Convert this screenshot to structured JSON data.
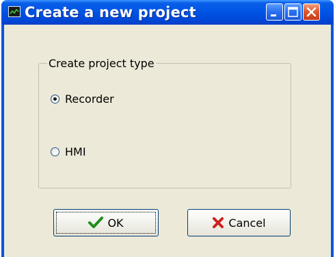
{
  "window": {
    "title": "Create a new project",
    "app_icon": "chart-monitor-icon",
    "controls": {
      "minimize_icon": "minimize-icon",
      "maximize_icon": "maximize-icon",
      "close_icon": "close-icon"
    }
  },
  "group": {
    "legend": "Create project type",
    "options": [
      {
        "label": "Recorder",
        "checked": true
      },
      {
        "label": "HMI",
        "checked": false
      }
    ]
  },
  "buttons": {
    "ok_label": "OK",
    "ok_icon": "checkmark-icon",
    "cancel_label": "Cancel",
    "cancel_icon": "red-x-icon"
  },
  "colors": {
    "titlebar": "#0055e5",
    "dialog_background": "#ece9d8",
    "close_button": "#e05a30",
    "ok_check": "#1e8c1e",
    "cancel_x": "#d0201a"
  }
}
